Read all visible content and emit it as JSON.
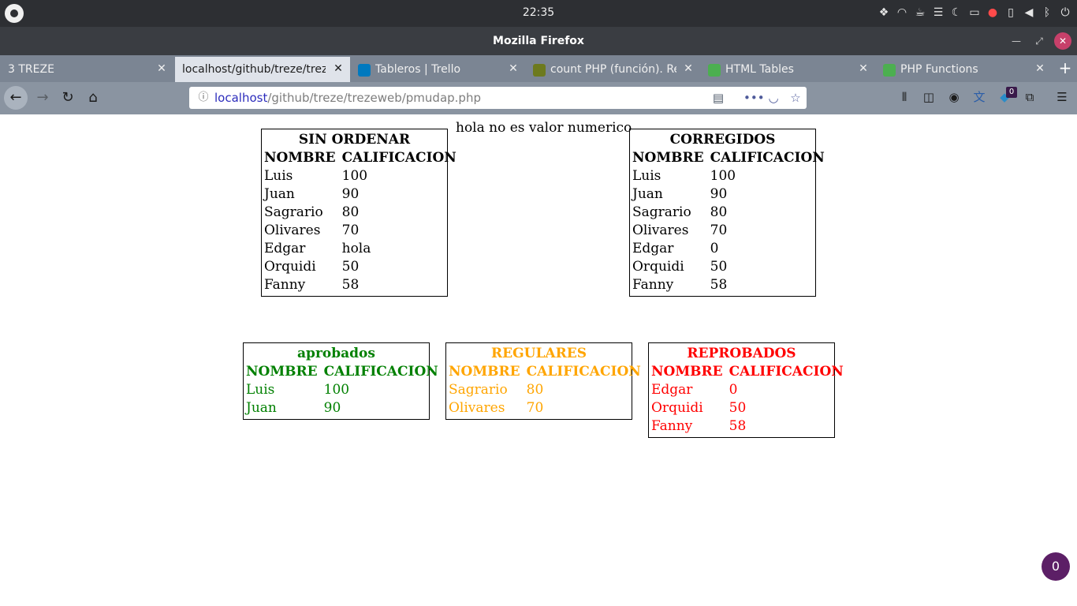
{
  "system": {
    "clock": "22:35",
    "tray_icons": [
      "dropbox-icon",
      "wifi-icon",
      "coffee-icon",
      "menu-icon",
      "moon-icon",
      "folder-icon",
      "bell-icon",
      "battery-icon",
      "volume-icon",
      "bluetooth-icon",
      "power-icon"
    ]
  },
  "window": {
    "title": "Mozilla Firefox",
    "close_color": "#c7406a"
  },
  "tabs": [
    {
      "title": "3 TREZE",
      "active": false
    },
    {
      "title": "localhost/github/treze/trezeweb/pmudap.php",
      "active": true
    },
    {
      "title": "Tableros | Trello",
      "active": false
    },
    {
      "title": "count PHP (función). Re",
      "active": false
    },
    {
      "title": "HTML Tables",
      "active": false
    },
    {
      "title": "PHP Functions",
      "active": false
    }
  ],
  "urlbar": {
    "host": "localhost",
    "path": "/github/treze/trezeweb/pmudap.php"
  },
  "toolbar": {
    "badge_count": "0"
  },
  "page": {
    "message": "hola no es valor numerico",
    "unsorted": {
      "caption": "SIN ORDENAR",
      "headers": [
        "NOMBRE",
        "CALIFICACION"
      ],
      "rows": [
        [
          "Luis",
          "100"
        ],
        [
          "Juan",
          "90"
        ],
        [
          "Sagrario",
          "80"
        ],
        [
          "Olivares",
          "70"
        ],
        [
          "Edgar",
          "hola"
        ],
        [
          "Orquidi",
          "50"
        ],
        [
          "Fanny",
          "58"
        ]
      ]
    },
    "corrected": {
      "caption": "CORREGIDOS",
      "headers": [
        "NOMBRE",
        "CALIFICACION"
      ],
      "rows": [
        [
          "Luis",
          "100"
        ],
        [
          "Juan",
          "90"
        ],
        [
          "Sagrario",
          "80"
        ],
        [
          "Olivares",
          "70"
        ],
        [
          "Edgar",
          "0"
        ],
        [
          "Orquidi",
          "50"
        ],
        [
          "Fanny",
          "58"
        ]
      ]
    },
    "approved": {
      "caption": "aprobados",
      "color": "#008000",
      "headers": [
        "NOMBRE",
        "CALIFICACION"
      ],
      "rows": [
        [
          "Luis",
          "100"
        ],
        [
          "Juan",
          "90"
        ]
      ]
    },
    "regular": {
      "caption": "REGULARES",
      "color": "#ffa500",
      "headers": [
        "NOMBRE",
        "CALIFICACION"
      ],
      "rows": [
        [
          "Sagrario",
          "80"
        ],
        [
          "Olivares",
          "70"
        ]
      ]
    },
    "failed": {
      "caption": "REPROBADOS",
      "color": "#ff0000",
      "headers": [
        "NOMBRE",
        "CALIFICACION"
      ],
      "rows": [
        [
          "Edgar",
          "0"
        ],
        [
          "Orquidi",
          "50"
        ],
        [
          "Fanny",
          "58"
        ]
      ]
    }
  },
  "fab": {
    "label": "0"
  }
}
